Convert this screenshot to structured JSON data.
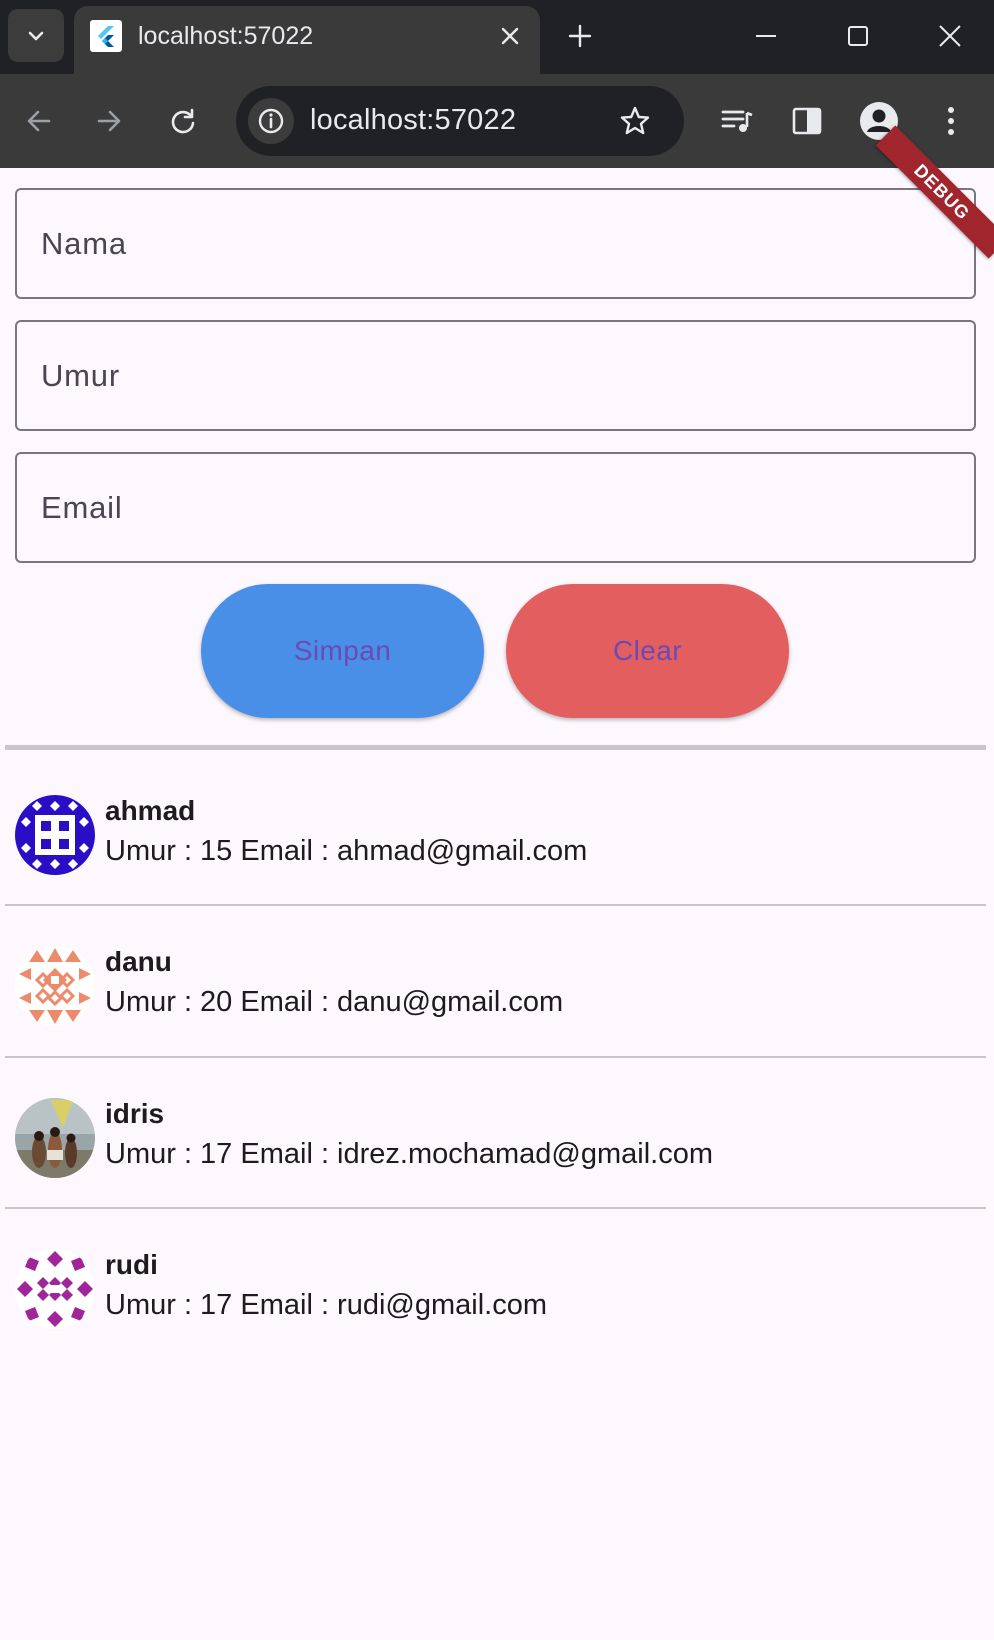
{
  "browser": {
    "tab_title": "localhost:57022",
    "url": "localhost:57022"
  },
  "form": {
    "fields": [
      {
        "label": "Nama"
      },
      {
        "label": "Umur"
      },
      {
        "label": "Email"
      }
    ],
    "save_label": "Simpan",
    "clear_label": "Clear"
  },
  "users": [
    {
      "name": "ahmad",
      "detail": "Umur : 15 Email : ahmad@gmail.com"
    },
    {
      "name": "danu",
      "detail": "Umur : 20 Email : danu@gmail.com"
    },
    {
      "name": "idris",
      "detail": "Umur : 17 Email : idrez.mochamad@gmail.com"
    },
    {
      "name": "rudi",
      "detail": "Umur : 17 Email : rudi@gmail.com"
    }
  ],
  "debug_banner": "DEBUG",
  "colors": {
    "save_button": "#4a8fe7",
    "clear_button": "#e35e5e",
    "button_text": "#6c4ab6",
    "debug_ribbon": "#a0252c"
  },
  "icons": [
    "tab-search-icon",
    "flutter-logo-icon",
    "close-icon",
    "new-tab-icon",
    "minimize-icon",
    "maximize-icon",
    "back-icon",
    "forward-icon",
    "reload-icon",
    "site-info-icon",
    "star-icon",
    "media-queue-icon",
    "side-panel-icon",
    "profile-icon",
    "more-menu-icon"
  ]
}
